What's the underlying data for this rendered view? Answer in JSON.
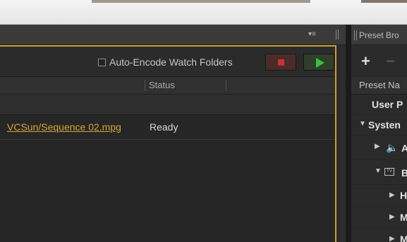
{
  "queue": {
    "panel_menu_icon": "panel-menu-icon",
    "auto_encode_label": "Auto-Encode Watch Folders",
    "auto_encode_checked": false,
    "columns": {
      "status": "Status"
    },
    "items": [
      {
        "output_file": "VCSun/Sequence 02.mpg",
        "status": "Ready"
      }
    ]
  },
  "preset_browser": {
    "title": "Preset Bro",
    "column_header": "Preset Na",
    "tree": {
      "user_presets": "User P",
      "system_presets": "Systen",
      "audio_item": "A",
      "broadcast_item": "B",
      "sub1": "H",
      "sub2": "M",
      "sub3": "M"
    }
  },
  "colors": {
    "accent": "#c9a030",
    "play": "#33c43a",
    "stop": "#c63333"
  }
}
